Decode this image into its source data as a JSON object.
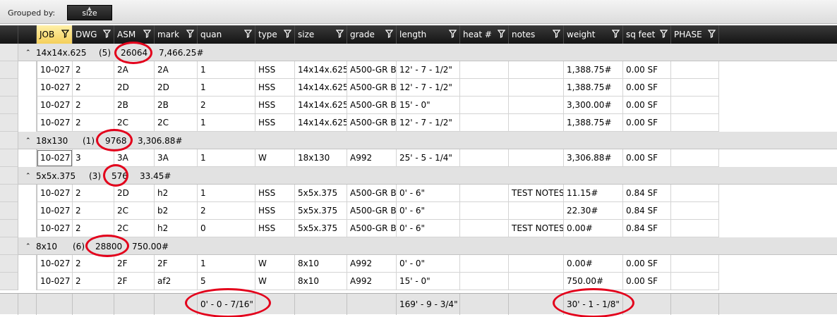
{
  "group_panel": {
    "label": "Grouped by:",
    "chip": "size"
  },
  "columns": [
    {
      "id": "job",
      "label": "JOB"
    },
    {
      "id": "dwg",
      "label": "DWG"
    },
    {
      "id": "asm",
      "label": "ASM"
    },
    {
      "id": "mark",
      "label": "mark"
    },
    {
      "id": "quan",
      "label": "quan"
    },
    {
      "id": "type",
      "label": "type"
    },
    {
      "id": "size",
      "label": "size"
    },
    {
      "id": "grade",
      "label": "grade"
    },
    {
      "id": "length",
      "label": "length"
    },
    {
      "id": "heat",
      "label": "heat #"
    },
    {
      "id": "notes",
      "label": "notes"
    },
    {
      "id": "weight",
      "label": "weight"
    },
    {
      "id": "sqfeet",
      "label": "sq feet"
    },
    {
      "id": "phase",
      "label": "PHASE"
    }
  ],
  "groups": [
    {
      "name": "14x14x.625",
      "count": "(5)",
      "total": "26064",
      "weight": "7,466.25#",
      "rows": [
        [
          "10-027",
          "2",
          "2A",
          "2A",
          "1",
          "HSS",
          "14x14x.625",
          "A500-GR B",
          "12' - 7 - 1/2\"",
          "",
          "",
          "1,388.75#",
          "0.00 SF",
          ""
        ],
        [
          "10-027",
          "2",
          "2D",
          "2D",
          "1",
          "HSS",
          "14x14x.625",
          "A500-GR B",
          "12' - 7 - 1/2\"",
          "",
          "",
          "1,388.75#",
          "0.00 SF",
          ""
        ],
        [
          "10-027",
          "2",
          "2B",
          "2B",
          "2",
          "HSS",
          "14x14x.625",
          "A500-GR B",
          "15' - 0\"",
          "",
          "",
          "3,300.00#",
          "0.00 SF",
          ""
        ],
        [
          "10-027",
          "2",
          "2C",
          "2C",
          "1",
          "HSS",
          "14x14x.625",
          "A500-GR B",
          "12' - 7 - 1/2\"",
          "",
          "",
          "1,388.75#",
          "0.00 SF",
          ""
        ]
      ]
    },
    {
      "name": "18x130",
      "count": "(1)",
      "total": "9768",
      "weight": "3,306.88#",
      "rows": [
        [
          "10-027",
          "3",
          "3A",
          "3A",
          "1",
          "W",
          "18x130",
          "A992",
          "25' - 5 - 1/4\"",
          "",
          "",
          "3,306.88#",
          "0.00 SF",
          ""
        ]
      ]
    },
    {
      "name": "5x5x.375",
      "count": "(3)",
      "total": "576",
      "weight": "33.45#",
      "rows": [
        [
          "10-027",
          "2",
          "2D",
          "h2",
          "1",
          "HSS",
          "5x5x.375",
          "A500-GR B",
          "0' - 6\"",
          "",
          "TEST NOTES",
          "11.15#",
          "0.84 SF",
          ""
        ],
        [
          "10-027",
          "2",
          "2C",
          "b2",
          "2",
          "HSS",
          "5x5x.375",
          "A500-GR B",
          "0' - 6\"",
          "",
          "",
          "22.30#",
          "0.84 SF",
          ""
        ],
        [
          "10-027",
          "2",
          "2C",
          "h2",
          "0",
          "HSS",
          "5x5x.375",
          "A500-GR B",
          "0' - 6\"",
          "",
          "TEST NOTES",
          "0.00#",
          "0.84 SF",
          ""
        ]
      ]
    },
    {
      "name": "8x10",
      "count": "(6)",
      "total": "28800",
      "weight": "750.00#",
      "rows": [
        [
          "10-027",
          "2",
          "2F",
          "2F",
          "1",
          "W",
          "8x10",
          "A992",
          "0' - 0\"",
          "",
          "",
          "0.00#",
          "0.00 SF",
          ""
        ],
        [
          "10-027",
          "2",
          "2F",
          "af2",
          "5",
          "W",
          "8x10",
          "A992",
          "15' - 0\"",
          "",
          "",
          "750.00#",
          "0.00 SF",
          ""
        ]
      ]
    }
  ],
  "footer": {
    "quan": "0' - 0 - 7/16\"",
    "length": "169' - 9 - 3/4\"",
    "weight": "30' - 1 - 1/8\""
  },
  "colors": {
    "header_bg": "#1e1e1e",
    "active_header": "#f6d56a",
    "group_row_bg": "#e2e2e2",
    "annotation": "#e3001b"
  },
  "icons": {
    "filter": "filter-icon",
    "expander": "collapse-arrow-icon",
    "sort": "sort-up-icon"
  }
}
